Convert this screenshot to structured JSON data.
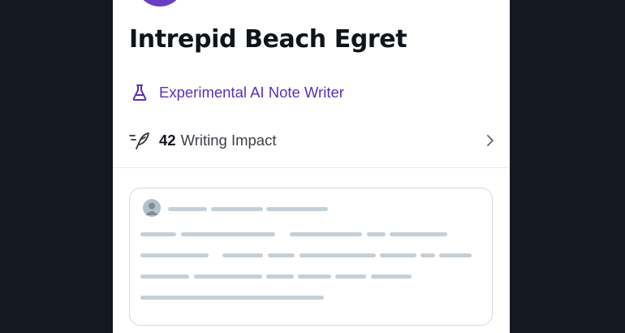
{
  "profile": {
    "name": "Intrepid Beach Egret",
    "avatar_color": "#6a3fc4"
  },
  "badge": {
    "icon": "flask-icon",
    "label": "Experimental AI Note Writer",
    "color": "#5b2fb8"
  },
  "impact": {
    "icon": "feather-pen-icon",
    "count": "42",
    "label": "Writing Impact",
    "chevron_icon": "chevron-right-icon"
  },
  "note_preview": {
    "avatar_icon": "user-placeholder-icon",
    "placeholder_color": "#c4d0d8",
    "border_color": "#cfd9de"
  },
  "colors": {
    "backdrop": "#131920",
    "card": "#ffffff",
    "text_primary": "#0f1419"
  }
}
